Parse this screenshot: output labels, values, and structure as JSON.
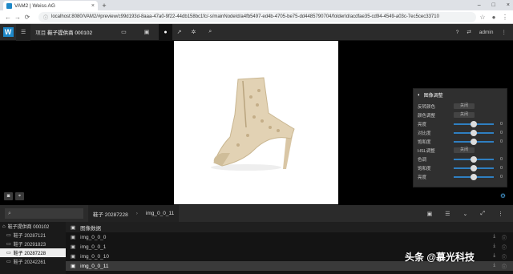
{
  "browser": {
    "tab_title": "VAM2 | Weiss AG",
    "tab_close": "×",
    "new_tab": "+",
    "window_controls": [
      "–",
      "□",
      "×"
    ],
    "url": "localhost:8080/VAM2/#preview/c99d193d-8aaa-47a0-9f22-44db158bc1fc/-s/mainNodeId/a4fb5497-ed4b-4705-be75-dd4485790704/folderId/acdfae35-cd94-4549-a03c-7ec5cec33710"
  },
  "header": {
    "logo": "W",
    "project_label": "项目",
    "project_name": "鞋子提供商 000102",
    "help": "?",
    "share": "⇄",
    "user": "admin"
  },
  "adjust_panel": {
    "title": "图像调整",
    "rows": [
      {
        "label": "反转颜色",
        "type": "toggle",
        "toggle_text": "关闭"
      },
      {
        "label": "颜色调整",
        "type": "toggle",
        "toggle_text": "关闭"
      },
      {
        "label": "亮度",
        "type": "slider",
        "value": "0",
        "fraction": 0.5
      },
      {
        "label": "对比度",
        "type": "slider",
        "value": "0",
        "fraction": 0.5
      },
      {
        "label": "饱和度",
        "type": "slider",
        "value": "0",
        "fraction": 0.5
      },
      {
        "label": "HSL调整",
        "type": "toggle",
        "toggle_text": "关闭"
      },
      {
        "label": "色调",
        "type": "slider",
        "value": "0",
        "fraction": 0.5
      },
      {
        "label": "饱和度",
        "type": "slider",
        "value": "0",
        "fraction": 0.5
      },
      {
        "label": "亮度",
        "type": "slider",
        "value": "0",
        "fraction": 0.5
      }
    ]
  },
  "lower": {
    "search_placeholder": "",
    "crumb_folder": "鞋子 20287228",
    "crumb_file": "img_0_0_11"
  },
  "tree": {
    "root": "鞋子提供商 000102",
    "folders": [
      "鞋子 20287121",
      "鞋子 20291823",
      "鞋子 20287228",
      "鞋子 20242261"
    ],
    "selected_index": 2
  },
  "files": {
    "header": "图像数据",
    "items": [
      "img_0_0_0",
      "img_0_0_1",
      "img_0_0_10",
      "img_0_0_11"
    ],
    "selected_index": 3
  },
  "watermark": "头条 @慕光科技",
  "colors": {
    "accent": "#1e88c8",
    "slider": "#2f7fc1"
  }
}
